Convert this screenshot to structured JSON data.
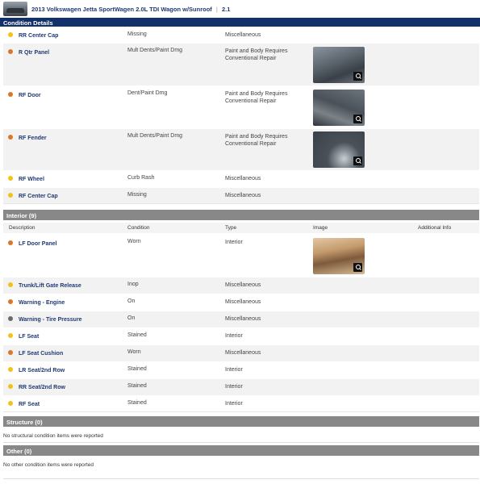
{
  "header": {
    "vehicle_title": "2013 Volkswagen Jetta SportWagen 2.0L TDI Wagon w/Sunroof",
    "separator": "|",
    "grade": "2.1"
  },
  "condition_details": {
    "title": "Condition Details",
    "items": [
      {
        "description": "RR Center Cap",
        "condition": "Missing",
        "type": "Miscellaneous",
        "severity": "yellow"
      },
      {
        "description": "R Qtr Panel",
        "condition": "Mult Dents/Paint Dmg",
        "type": "Paint and Body Requires Conventional Repair",
        "severity": "orange"
      },
      {
        "description": "RF Door",
        "condition": "Dent/Paint Dmg",
        "type": "Paint and Body Requires Conventional Repair",
        "severity": "orange"
      },
      {
        "description": "RF Fender",
        "condition": "Mult Dents/Paint Dmg",
        "type": "Paint and Body Requires Conventional Repair",
        "severity": "orange"
      },
      {
        "description": "RF Wheel",
        "condition": "Curb Rash",
        "type": "Miscellaneous",
        "severity": "yellow"
      },
      {
        "description": "RF Center Cap",
        "condition": "Missing",
        "type": "Miscellaneous",
        "severity": "yellow"
      }
    ]
  },
  "interior": {
    "title": "Interior (9)",
    "columns": [
      "Description",
      "Condition",
      "Type",
      "Image",
      "Additional Info"
    ],
    "items": [
      {
        "description": "LF Door Panel",
        "condition": "Worn",
        "type": "Interior",
        "severity": "orange"
      },
      {
        "description": "Trunk/Lift Gate Release",
        "condition": "Inop",
        "type": "Miscellaneous",
        "severity": "yellow"
      },
      {
        "description": "Warning - Engine",
        "condition": "On",
        "type": "Miscellaneous",
        "severity": "orange"
      },
      {
        "description": "Warning - Tire Pressure",
        "condition": "On",
        "type": "Miscellaneous",
        "severity": "gray"
      },
      {
        "description": "LF Seat",
        "condition": "Stained",
        "type": "Interior",
        "severity": "yellow"
      },
      {
        "description": "LF Seat Cushion",
        "condition": "Worn",
        "type": "Miscellaneous",
        "severity": "orange"
      },
      {
        "description": "LR Seat/2nd Row",
        "condition": "Stained",
        "type": "Interior",
        "severity": "yellow"
      },
      {
        "description": "RR Seat/2nd Row",
        "condition": "Stained",
        "type": "Interior",
        "severity": "yellow"
      },
      {
        "description": "RF Seat",
        "condition": "Stained",
        "type": "Interior",
        "severity": "yellow"
      }
    ]
  },
  "structure": {
    "title": "Structure (0)",
    "note": "No structural condition items were reported"
  },
  "other": {
    "title": "Other (0)",
    "note": "No other condition items were reported"
  },
  "colors": {
    "navy": "#12306a",
    "link": "#1f3a72",
    "yellow": "#f2c21a",
    "orange": "#d9782c",
    "gray": "#6a6a6a",
    "section_gray": "#888888"
  },
  "icons": {
    "zoom": "zoom-magnifier-icon",
    "severity": "severity-dot-icon"
  }
}
